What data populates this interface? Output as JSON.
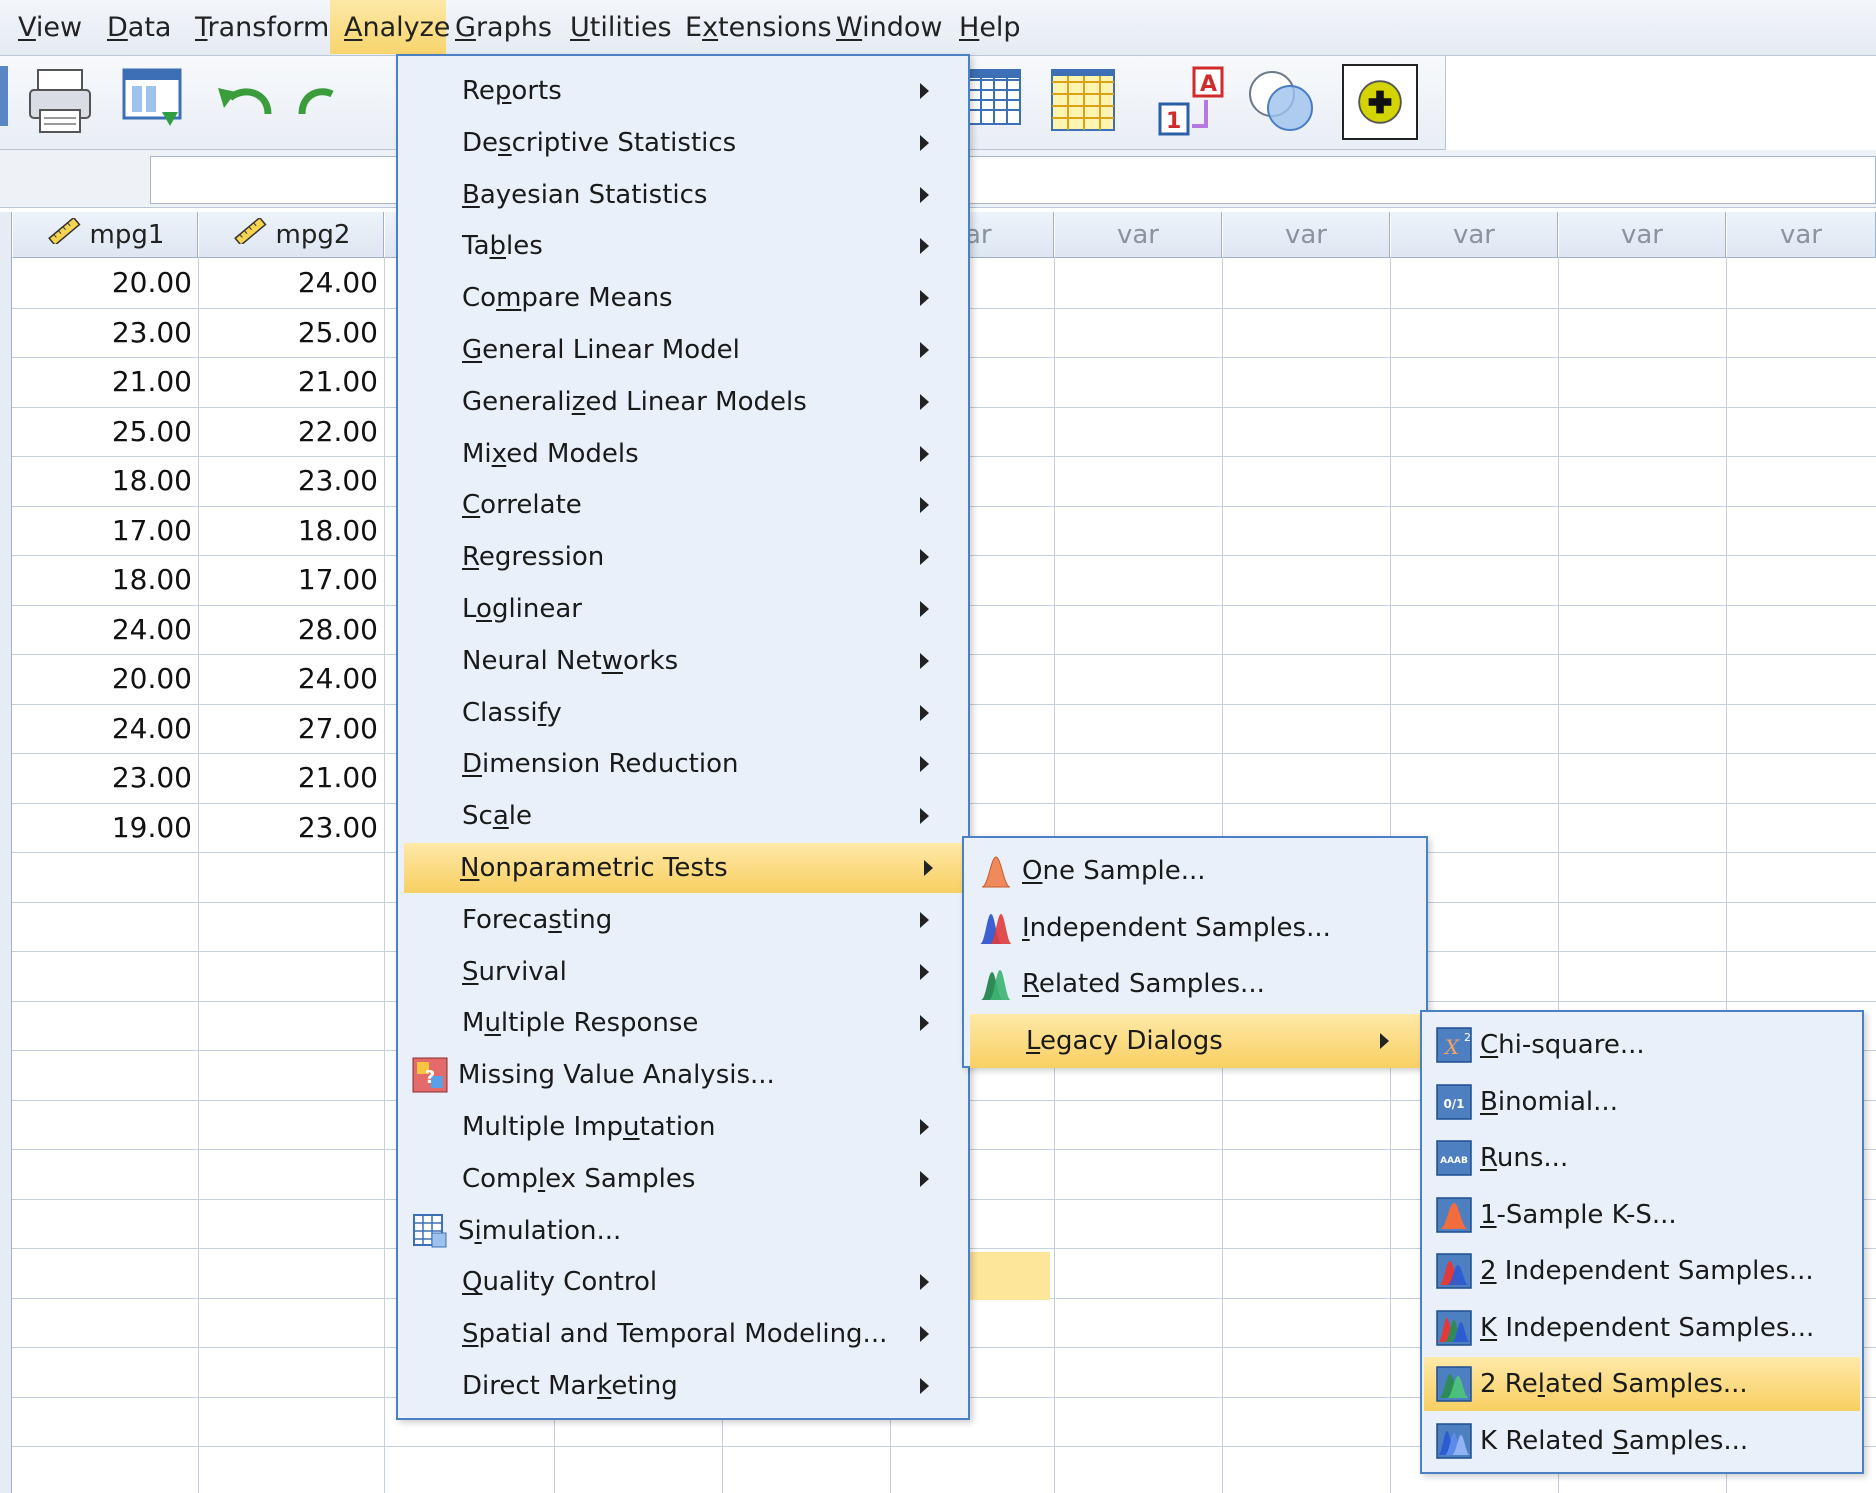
{
  "menubar": {
    "items": [
      {
        "label": "View",
        "u": "V",
        "rest": "iew"
      },
      {
        "label": "Data",
        "u": "D",
        "rest": "ata"
      },
      {
        "label": "Transform",
        "u": "T",
        "rest": "ransform"
      },
      {
        "label": "Analyze",
        "u": "A",
        "rest": "nalyze"
      },
      {
        "label": "Graphs",
        "u": "G",
        "rest": "raphs"
      },
      {
        "label": "Utilities",
        "u": "U",
        "rest": "tilities"
      },
      {
        "label": "Extensions",
        "pre": "E",
        "u": "x",
        "rest": "tensions"
      },
      {
        "label": "Window",
        "u": "W",
        "rest": "indow"
      },
      {
        "label": "Help",
        "u": "H",
        "rest": "elp"
      }
    ],
    "active": "Analyze"
  },
  "grid": {
    "columns": [
      {
        "name": "mpg1",
        "type": "scale"
      },
      {
        "name": "mpg2",
        "type": "scale"
      }
    ],
    "var_label": "var",
    "var_partial_label": "ar",
    "rows": [
      [
        "20.00",
        "24.00"
      ],
      [
        "23.00",
        "25.00"
      ],
      [
        "21.00",
        "21.00"
      ],
      [
        "25.00",
        "22.00"
      ],
      [
        "18.00",
        "23.00"
      ],
      [
        "17.00",
        "18.00"
      ],
      [
        "18.00",
        "17.00"
      ],
      [
        "24.00",
        "28.00"
      ],
      [
        "20.00",
        "24.00"
      ],
      [
        "24.00",
        "27.00"
      ],
      [
        "23.00",
        "21.00"
      ],
      [
        "19.00",
        "23.00"
      ]
    ]
  },
  "analyze_menu": {
    "items": [
      {
        "pre": "Re",
        "u": "p",
        "rest": "orts",
        "submenu": true
      },
      {
        "pre": "De",
        "u": "s",
        "rest": "criptive Statistics",
        "submenu": true
      },
      {
        "pre": "",
        "u": "B",
        "rest": "ayesian Statistics",
        "submenu": true
      },
      {
        "pre": "Ta",
        "u": "b",
        "rest": "les",
        "submenu": true
      },
      {
        "pre": "Co",
        "u": "m",
        "rest": "pare Means",
        "submenu": true
      },
      {
        "pre": "",
        "u": "G",
        "rest": "eneral Linear Model",
        "submenu": true
      },
      {
        "pre": "Generali",
        "u": "z",
        "rest": "ed Linear Models",
        "submenu": true
      },
      {
        "pre": "Mi",
        "u": "x",
        "rest": "ed Models",
        "submenu": true
      },
      {
        "pre": "",
        "u": "C",
        "rest": "orrelate",
        "submenu": true
      },
      {
        "pre": "",
        "u": "R",
        "rest": "egression",
        "submenu": true
      },
      {
        "pre": "L",
        "u": "o",
        "rest": "glinear",
        "submenu": true
      },
      {
        "pre": "Neural Net",
        "u": "w",
        "rest": "orks",
        "submenu": true
      },
      {
        "pre": "Classi",
        "u": "f",
        "rest": "y",
        "submenu": true
      },
      {
        "pre": "",
        "u": "D",
        "rest": "imension Reduction",
        "submenu": true
      },
      {
        "pre": "Sc",
        "u": "a",
        "rest": "le",
        "submenu": true
      },
      {
        "pre": "",
        "u": "N",
        "rest": "onparametric Tests",
        "submenu": true,
        "highlighted": true
      },
      {
        "pre": "Foreca",
        "u": "s",
        "rest": "ting",
        "submenu": true
      },
      {
        "pre": "",
        "u": "S",
        "rest": "urvival",
        "submenu": true
      },
      {
        "pre": "M",
        "u": "u",
        "rest": "ltiple Response",
        "submenu": true
      },
      {
        "pre": "",
        "u": "",
        "rest": "Missing Value Analysis...",
        "submenu": false,
        "icon": "missing-value-icon"
      },
      {
        "pre": "Multiple Imp",
        "u": "u",
        "rest": "tation",
        "submenu": true
      },
      {
        "pre": "Comp",
        "u": "l",
        "rest": "ex Samples",
        "submenu": true
      },
      {
        "pre": "S",
        "u": "i",
        "rest": "mulation...",
        "submenu": false,
        "icon": "simulation-icon"
      },
      {
        "pre": "",
        "u": "Q",
        "rest": "uality Control",
        "submenu": true
      },
      {
        "pre": "",
        "u": "S",
        "rest": "patial and Temporal Modeling...",
        "submenu": true
      },
      {
        "pre": "Direct Mar",
        "u": "k",
        "rest": "eting",
        "submenu": true
      }
    ]
  },
  "nonparametric_menu": {
    "items": [
      {
        "pre": "",
        "u": "O",
        "rest": "ne Sample...",
        "icon": "one-sample-icon"
      },
      {
        "pre": "",
        "u": "I",
        "rest": "ndependent Samples...",
        "icon": "independent-samples-icon"
      },
      {
        "pre": "",
        "u": "R",
        "rest": "elated Samples...",
        "icon": "related-samples-icon"
      },
      {
        "pre": "",
        "u": "L",
        "rest": "egacy Dialogs",
        "submenu": true,
        "highlighted": true
      }
    ]
  },
  "legacy_menu": {
    "items": [
      {
        "pre": "",
        "u": "C",
        "rest": "hi-square...",
        "icon": "chi-square-icon"
      },
      {
        "pre": "",
        "u": "B",
        "rest": "inomial...",
        "icon": "binomial-icon"
      },
      {
        "pre": "",
        "u": "R",
        "rest": "uns...",
        "icon": "runs-icon"
      },
      {
        "pre": "",
        "u": "1",
        "rest": "-Sample K-S...",
        "icon": "ks-icon"
      },
      {
        "pre": "",
        "u": "2",
        "rest": " Independent Samples...",
        "icon": "two-independent-icon"
      },
      {
        "pre": "",
        "u": "K",
        "rest": " Independent Samples...",
        "icon": "k-independent-icon"
      },
      {
        "pre": "2 Re",
        "u": "l",
        "rest": "ated Samples...",
        "icon": "two-related-icon",
        "highlighted": true
      },
      {
        "pre": "K Related ",
        "u": "S",
        "rest": "amples...",
        "icon": "k-related-icon"
      }
    ]
  }
}
